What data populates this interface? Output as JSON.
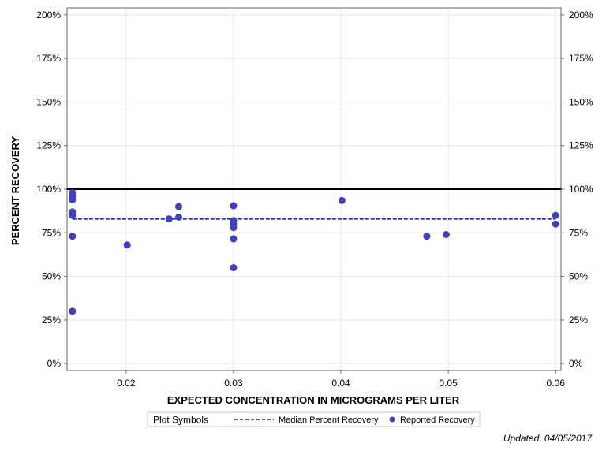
{
  "chart_data": {
    "type": "scatter",
    "title": "",
    "xlabel": "EXPECTED CONCENTRATION IN MICROGRAMS PER LITER",
    "ylabel": "PERCENT RECOVERY",
    "xlim": [
      0.0145,
      0.0605
    ],
    "ylim": [
      -0.04,
      2.04
    ],
    "x_ticks": [
      0.02,
      0.03,
      0.04,
      0.05,
      0.06
    ],
    "x_tick_labels": [
      "0.02",
      "0.03",
      "0.04",
      "0.05",
      "0.06"
    ],
    "y_ticks": [
      0,
      0.25,
      0.5,
      0.75,
      1.0,
      1.25,
      1.5,
      1.75,
      2.0
    ],
    "y_tick_labels": [
      "0%",
      "25%",
      "50%",
      "75%",
      "100%",
      "125%",
      "150%",
      "175%",
      "200%"
    ],
    "grid": true,
    "reference_line": {
      "y": 1.0,
      "color": "#000000"
    },
    "series": [
      {
        "name": "Median Percent Recovery",
        "kind": "line",
        "style": "dashed",
        "color": "#1f1fdc",
        "x": [
          0.015,
          0.06
        ],
        "y": [
          0.83,
          0.83
        ]
      },
      {
        "name": "Reported Recovery",
        "kind": "points",
        "color": "#3f3fbf",
        "points": [
          [
            0.015,
            0.98
          ],
          [
            0.015,
            0.96
          ],
          [
            0.015,
            0.94
          ],
          [
            0.015,
            0.87
          ],
          [
            0.015,
            0.85
          ],
          [
            0.015,
            0.73
          ],
          [
            0.015,
            0.3
          ],
          [
            0.0201,
            0.68
          ],
          [
            0.024,
            0.83
          ],
          [
            0.0249,
            0.9
          ],
          [
            0.0249,
            0.84
          ],
          [
            0.03,
            0.905
          ],
          [
            0.03,
            0.82
          ],
          [
            0.03,
            0.8
          ],
          [
            0.03,
            0.78
          ],
          [
            0.03,
            0.715
          ],
          [
            0.03,
            0.55
          ],
          [
            0.0401,
            0.935
          ],
          [
            0.048,
            0.73
          ],
          [
            0.0498,
            0.74
          ],
          [
            0.06,
            0.85
          ],
          [
            0.06,
            0.8
          ]
        ]
      }
    ],
    "legend": {
      "title": "Plot Symbols",
      "placement": "bottom-center",
      "entries": [
        "Median Percent Recovery",
        "Reported Recovery"
      ]
    }
  },
  "footer": {
    "updated": "Updated: 04/05/2017"
  },
  "colors": {
    "grid": "#e6e6e6",
    "axis": "#666666",
    "text": "#000000"
  }
}
